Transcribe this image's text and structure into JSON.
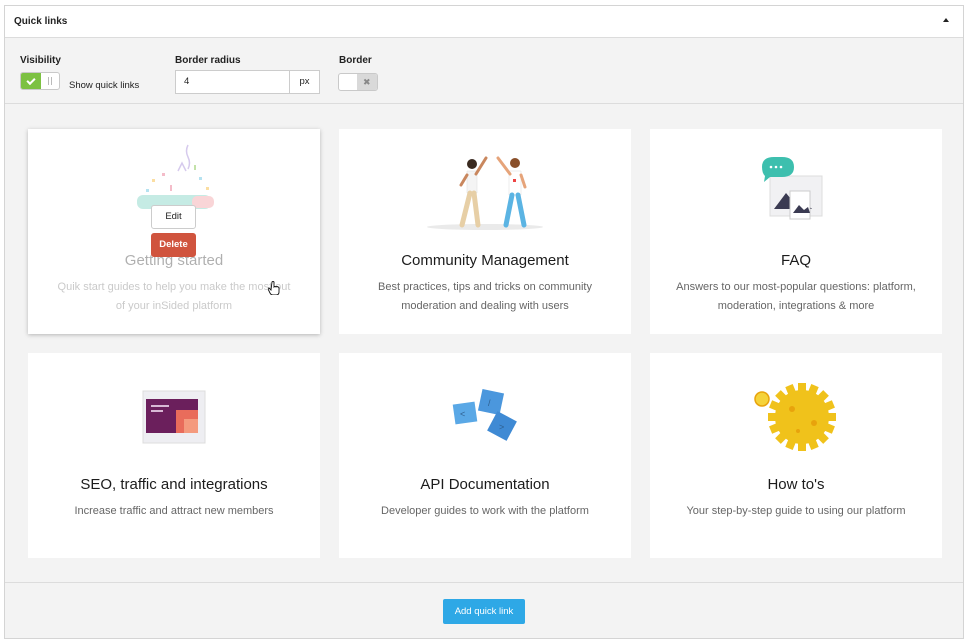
{
  "panel": {
    "title": "Quick links"
  },
  "settings": {
    "visibility_label": "Visibility",
    "show_quick_links_label": "Show quick links",
    "border_radius_label": "Border radius",
    "border_radius_value": "4",
    "border_radius_unit": "px",
    "border_label": "Border"
  },
  "cards": [
    {
      "title": "Getting started",
      "desc": "Quik start guides to help you make the most out of your inSided platform",
      "icon": "confetti-icon"
    },
    {
      "title": "Community Management",
      "desc": "Best practices, tips and tricks on community moderation and dealing with users",
      "icon": "high-five-icon"
    },
    {
      "title": "FAQ",
      "desc": "Answers to our most-popular questions: platform, moderation, integrations & more",
      "icon": "chat-images-icon"
    },
    {
      "title": "SEO, traffic and integrations",
      "desc": "Increase traffic and attract new members",
      "icon": "browser-window-icon"
    },
    {
      "title": "API Documentation",
      "desc": "Developer guides to work with the platform",
      "icon": "code-cubes-icon"
    },
    {
      "title": "How to's",
      "desc": "Your step-by-step guide to using our platform",
      "icon": "gear-icon"
    }
  ],
  "card_actions": {
    "edit": "Edit",
    "delete": "Delete"
  },
  "footer": {
    "add_label": "Add quick link"
  },
  "colors": {
    "accent": "#2ea8e6",
    "toggle_on": "#7cc142",
    "delete": "#d0543e"
  }
}
